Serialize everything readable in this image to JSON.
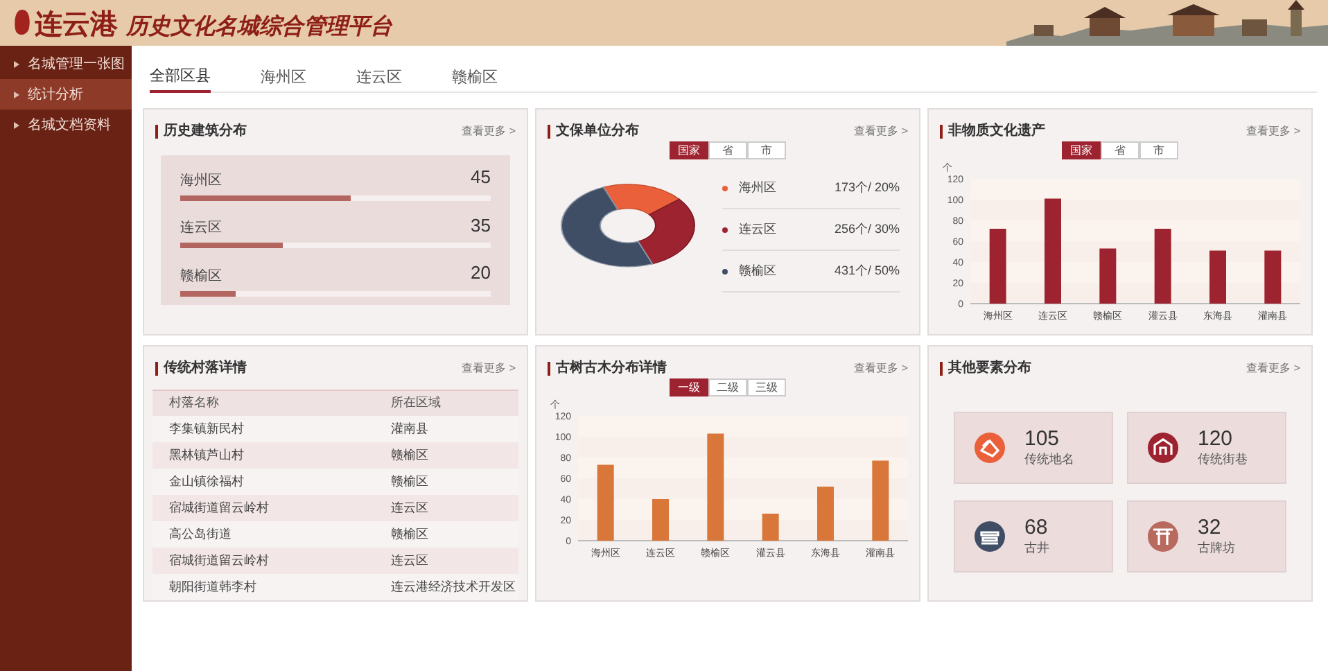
{
  "header": {
    "title_city": "连云港",
    "title_rest": "历史文化名城综合管理平台"
  },
  "sidebar": {
    "items": [
      {
        "label": "名城管理一张图",
        "selected": false
      },
      {
        "label": "统计分析",
        "selected": true
      },
      {
        "label": "名城文档资料",
        "selected": false
      }
    ]
  },
  "tabs": [
    {
      "label": "全部区县",
      "selected": true
    },
    {
      "label": "海州区",
      "selected": false
    },
    {
      "label": "连云区",
      "selected": false
    },
    {
      "label": "赣榆区",
      "selected": false
    }
  ],
  "history_buildings": {
    "title": "历史建筑分布",
    "more": "查看更多 >",
    "rows": [
      {
        "name": "海州区",
        "value": "45",
        "level": 0.55
      },
      {
        "name": "连云区",
        "value": "35",
        "level": 0.33
      },
      {
        "name": "赣榆区",
        "value": "20",
        "level": 0.18
      }
    ]
  },
  "protected_units": {
    "title": "文保单位分布",
    "more": "查看更多 >",
    "filters": [
      {
        "label": "国家",
        "selected": true
      },
      {
        "label": "省",
        "selected": false
      },
      {
        "label": "市",
        "selected": false
      }
    ],
    "chart_data": {
      "type": "donut",
      "categories": [
        "海州区",
        "连云区",
        "赣榆区"
      ],
      "values": [
        20,
        30,
        50
      ]
    },
    "legend": [
      {
        "value": "173个/ 20%",
        "color": "#e9603a"
      },
      {
        "value": "256个/ 30%",
        "color": "#9e2330"
      },
      {
        "value": "431个/ 50%",
        "color": "#3f4e65"
      }
    ]
  },
  "intangible_heritage": {
    "title": "非物质文化遗产",
    "more": "查看更多 >",
    "filters": [
      {
        "label": "国家",
        "selected": true
      },
      {
        "label": "省",
        "selected": false
      },
      {
        "label": "市",
        "selected": false
      }
    ],
    "chart_data": {
      "type": "bar",
      "ylabel": "个",
      "categories": [
        "海州区",
        "连云区",
        "赣榆区",
        "灌云县",
        "东海县",
        "灌南县"
      ],
      "series": [
        {
          "color": "#9e2330",
          "values": [
            72,
            101,
            53,
            72,
            51,
            51
          ]
        }
      ],
      "ylim": [
        0,
        120
      ],
      "yticks": [
        0,
        20,
        40,
        60,
        80,
        100,
        120
      ]
    }
  },
  "villages": {
    "title": "传统村落详情",
    "more": "查看更多 >",
    "columns": [
      "村落名称",
      "所在区域"
    ],
    "rows": [
      [
        "李集镇新民村",
        "灌南县"
      ],
      [
        "黑林镇芦山村",
        "赣榆区"
      ],
      [
        "金山镇徐福村",
        "赣榆区"
      ],
      [
        "宿城街道留云岭村",
        "连云区"
      ],
      [
        "高公岛街道",
        "赣榆区"
      ],
      [
        "宿城街道留云岭村",
        "连云区"
      ],
      [
        "朝阳街道韩李村",
        "连云港经济技术开发区"
      ]
    ]
  },
  "ancient_trees": {
    "title": "古树古木分布详情",
    "more": "查看更多 >",
    "filters": [
      {
        "label": "一级",
        "selected": true
      },
      {
        "label": "二级",
        "selected": false
      },
      {
        "label": "三级",
        "selected": false
      }
    ],
    "chart_data": {
      "type": "bar",
      "ylabel": "个",
      "categories": [
        "海州区",
        "连云区",
        "赣榆区",
        "灌云县",
        "东海县",
        "灌南县"
      ],
      "series": [
        {
          "color": "#d9773a",
          "values": [
            73,
            40,
            103,
            26,
            52,
            77
          ]
        }
      ],
      "ylim": [
        0,
        120
      ],
      "yticks": [
        0,
        20,
        40,
        60,
        80,
        100,
        120
      ]
    }
  },
  "other_elements": {
    "title": "其他要素分布",
    "more": "查看更多 >",
    "items": [
      {
        "kind": "placename",
        "value": "105",
        "label": "传统地名",
        "color": "#e9603a"
      },
      {
        "kind": "street",
        "value": "120",
        "label": "传统街巷",
        "color": "#9e2330"
      },
      {
        "kind": "well",
        "value": "68",
        "label": "古井",
        "color": "#3f4e65"
      },
      {
        "kind": "archway",
        "value": "32",
        "label": "古牌坊",
        "color": "#b86a5e"
      }
    ]
  }
}
